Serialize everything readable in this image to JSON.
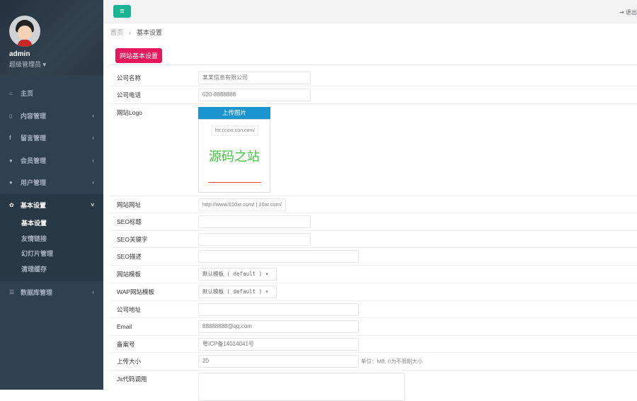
{
  "user": {
    "name": "admin",
    "role": "超级管理员"
  },
  "sidebar": {
    "items": [
      {
        "label": "主页",
        "icon": "home-icon"
      },
      {
        "label": "内容管理",
        "icon": "file-icon"
      },
      {
        "label": "留言管理",
        "icon": "facebook-icon"
      },
      {
        "label": "会员管理",
        "icon": "user-icon"
      },
      {
        "label": "用户管理",
        "icon": "user-icon"
      },
      {
        "label": "基本设置",
        "icon": "gear-icon"
      },
      {
        "label": "数据库管理",
        "icon": "database-icon"
      }
    ],
    "sub_items": [
      "基本设置",
      "友情链接",
      "幻灯片管理",
      "清理缓存"
    ]
  },
  "topbar": {
    "logout": "退出"
  },
  "breadcrumb": {
    "home": "首页",
    "current": "基本设置"
  },
  "tag": "网站基本设置",
  "form": {
    "company_name": {
      "label": "公司名称",
      "value": "某某信息有限公司"
    },
    "company_phone": {
      "label": "公司电话",
      "value": "020-8888888"
    },
    "logo": {
      "label": "网站Logo",
      "upload": "上传图片",
      "preview_url": "htr.ccoxr.con.com/",
      "preview_text": "源码之站"
    },
    "site_url": {
      "label": "网站网址",
      "value": "http://www.010xr.com/ | 10xr.com/"
    },
    "seo_title": {
      "label": "SEO标题",
      "value": ""
    },
    "seo_keywords": {
      "label": "SEO关键字",
      "value": ""
    },
    "seo_desc": {
      "label": "SEO描述",
      "value": ""
    },
    "template": {
      "label": "网站模板",
      "value": "默认模板 ( default ) ▾"
    },
    "wap_template": {
      "label": "WAP网站模板",
      "value": "默认模板 ( default ) ▾"
    },
    "address": {
      "label": "公司地址",
      "value": ""
    },
    "email": {
      "label": "Email",
      "value": "88888888@qq.com"
    },
    "icp": {
      "label": "备案号",
      "value": "粤ICP备14014041号"
    },
    "upload_size": {
      "label": "上传大小",
      "value": "20",
      "hint": "单位：MB, 0为不限制大小"
    },
    "js_code": {
      "label": "Js代码调用",
      "value": ""
    }
  }
}
